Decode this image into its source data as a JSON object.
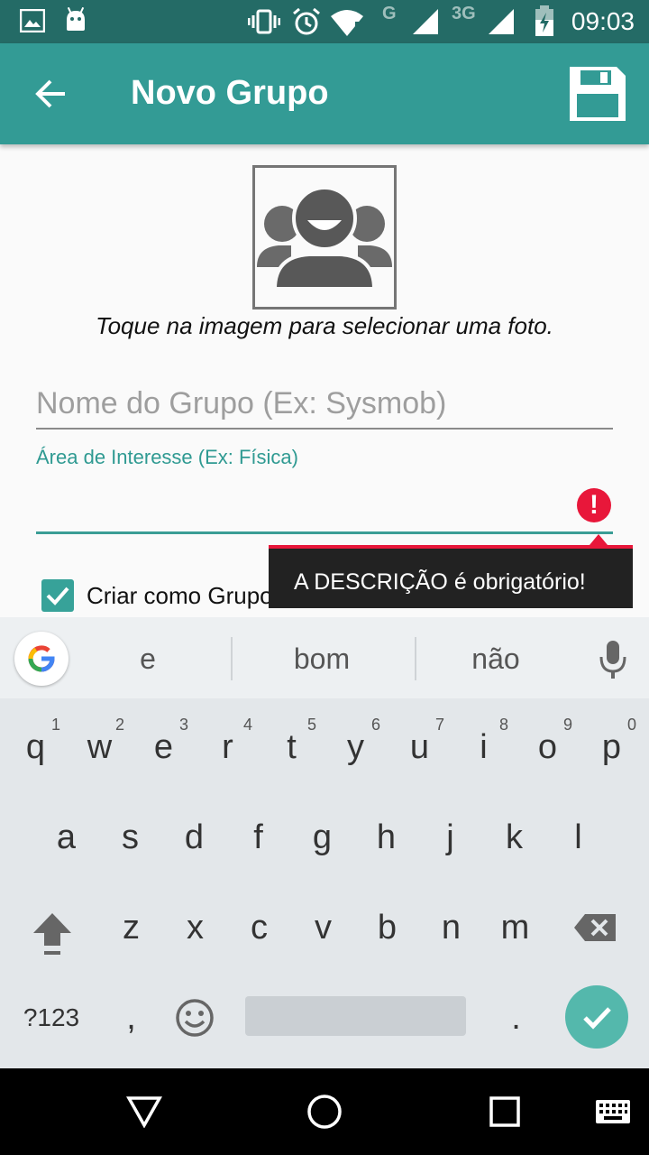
{
  "status_bar": {
    "time": "09:03",
    "network_1": "G",
    "network_2": "3G",
    "icons": [
      "image-icon",
      "android-icon",
      "vibrate-icon",
      "alarm-icon",
      "wifi-icon",
      "signal-icon",
      "signal-icon",
      "battery-charging-icon"
    ]
  },
  "app_bar": {
    "title": "Novo Grupo",
    "back_icon": "arrow-back-icon",
    "save_icon": "save-icon",
    "color": "#339b95"
  },
  "photo": {
    "icon": "group-avatar-icon",
    "hint": "Toque na imagem para selecionar uma foto."
  },
  "form": {
    "name_placeholder": "Nome do Grupo (Ex: Sysmob)",
    "area_label": "Área de Interesse (Ex: Física)",
    "area_value": "",
    "error_icon": "!",
    "error_message": "A DESCRIÇÃO é obrigatório!",
    "private_label": "Criar como Grupo Privado",
    "private_checked": true,
    "accent_color": "#339b95",
    "error_color": "#e8173a"
  },
  "keyboard": {
    "suggestions": [
      "e",
      "bom",
      "não"
    ],
    "row1": [
      {
        "k": "q",
        "h": "1"
      },
      {
        "k": "w",
        "h": "2"
      },
      {
        "k": "e",
        "h": "3"
      },
      {
        "k": "r",
        "h": "4"
      },
      {
        "k": "t",
        "h": "5"
      },
      {
        "k": "y",
        "h": "6"
      },
      {
        "k": "u",
        "h": "7"
      },
      {
        "k": "i",
        "h": "8"
      },
      {
        "k": "o",
        "h": "9"
      },
      {
        "k": "p",
        "h": "0"
      }
    ],
    "row2": [
      "a",
      "s",
      "d",
      "f",
      "g",
      "h",
      "j",
      "k",
      "l"
    ],
    "row3": [
      "z",
      "x",
      "c",
      "v",
      "b",
      "n",
      "m"
    ],
    "symbols_key": "?123",
    "comma_key": ",",
    "period_key": "."
  }
}
